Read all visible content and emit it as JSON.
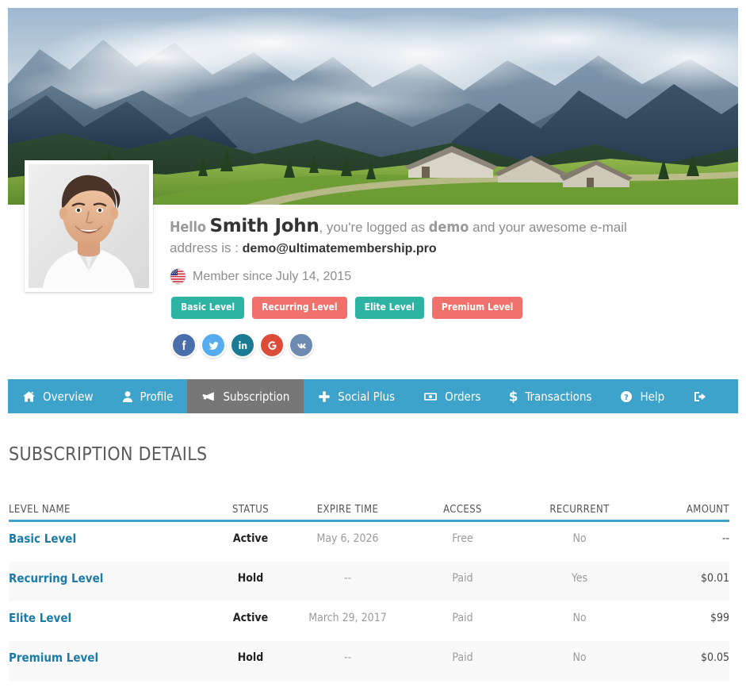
{
  "cover": {
    "alt": "mountain-valley-cover-photo"
  },
  "avatar": {
    "alt": "user-profile-photo"
  },
  "greeting": {
    "hello": "Hello",
    "name": "Smith John",
    "middle": ", you're logged as ",
    "username": "demo",
    "tail": " and your awesome e-mail",
    "address_label": "address is : ",
    "email": "demo@ultimatemembership.pro"
  },
  "member_since": {
    "flag": "us-flag-icon",
    "text": "Member since July 14, 2015"
  },
  "badges": [
    {
      "label": "Basic Level",
      "color": "#2cb3a1"
    },
    {
      "label": "Recurring Level",
      "color": "#f0716b"
    },
    {
      "label": "Elite Level",
      "color": "#2cb3a1"
    },
    {
      "label": "Premium Level",
      "color": "#f0716b"
    }
  ],
  "socials": [
    {
      "name": "facebook",
      "color": "#4a6ea9"
    },
    {
      "name": "twitter",
      "color": "#55acee"
    },
    {
      "name": "linkedin",
      "color": "#1b7b94"
    },
    {
      "name": "google",
      "color": "#dd4b39"
    },
    {
      "name": "vk",
      "color": "#6d8ab0"
    }
  ],
  "nav": {
    "accent": "#3ea3cb",
    "active_bg": "#777777",
    "items": [
      {
        "label": "Overview",
        "icon": "home-icon",
        "active": false
      },
      {
        "label": "Profile",
        "icon": "user-icon",
        "active": false
      },
      {
        "label": "Subscription",
        "icon": "megaphone-icon",
        "active": true
      },
      {
        "label": "Social Plus",
        "icon": "plus-icon",
        "active": false
      },
      {
        "label": "Orders",
        "icon": "banknote-icon",
        "active": false
      },
      {
        "label": "Transactions",
        "icon": "dollar-icon",
        "active": false
      },
      {
        "label": "Help",
        "icon": "question-icon",
        "active": false
      },
      {
        "label": "",
        "icon": "logout-icon",
        "active": false
      }
    ]
  },
  "section": {
    "title": "SUBSCRIPTION DETAILS"
  },
  "table": {
    "columns": [
      "LEVEL NAME",
      "STATUS",
      "EXPIRE TIME",
      "ACCESS",
      "RECURRENT",
      "AMOUNT"
    ],
    "rows": [
      {
        "level": "Basic Level",
        "status": "Active",
        "expire": "May 6, 2026",
        "access": "Free",
        "recurrent": "No",
        "amount": "--"
      },
      {
        "level": "Recurring Level",
        "status": "Hold",
        "expire": "--",
        "access": "Paid",
        "recurrent": "Yes",
        "amount": "$0.01"
      },
      {
        "level": "Elite Level",
        "status": "Active",
        "expire": "March 29, 2017",
        "access": "Paid",
        "recurrent": "No",
        "amount": "$99"
      },
      {
        "level": "Premium Level",
        "status": "Hold",
        "expire": "--",
        "access": "Paid",
        "recurrent": "No",
        "amount": "$0.05"
      }
    ]
  }
}
